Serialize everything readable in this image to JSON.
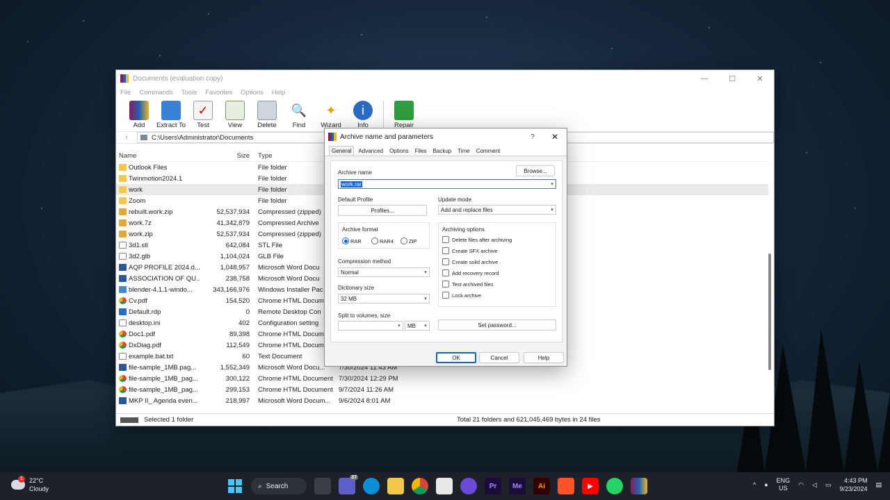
{
  "window": {
    "title": "Documents (evaluation copy)",
    "menu": [
      "File",
      "Commands",
      "Tools",
      "Favorites",
      "Options",
      "Help"
    ],
    "toolbar": [
      "Add",
      "Extract To",
      "Test",
      "View",
      "Delete",
      "Find",
      "Wizard",
      "Info",
      "Repair"
    ],
    "path": "C:\\Users\\Administrator\\Documents",
    "columns": {
      "name": "Name",
      "size": "Size",
      "type": "Type"
    },
    "files": [
      {
        "name": "Outlook Files",
        "size": "",
        "type": "File folder",
        "modified": "",
        "icon": "folder"
      },
      {
        "name": "Twinmotion2024.1",
        "size": "",
        "type": "File folder",
        "modified": "",
        "icon": "folder"
      },
      {
        "name": "work",
        "size": "",
        "type": "File folder",
        "modified": "",
        "icon": "folder"
      },
      {
        "name": "Zoom",
        "size": "",
        "type": "File folder",
        "modified": "",
        "icon": "folder"
      },
      {
        "name": "rebuilt.work.zip",
        "size": "52,537,934",
        "type": "Compressed (zipped)",
        "modified": "",
        "icon": "zip"
      },
      {
        "name": "work.7z",
        "size": "41,342,879",
        "type": "Compressed Archive",
        "modified": "",
        "icon": "zip"
      },
      {
        "name": "work.zip",
        "size": "52,537,934",
        "type": "Compressed (zipped)",
        "modified": "",
        "icon": "zip"
      },
      {
        "name": "3d1.stl",
        "size": "642,084",
        "type": "STL File",
        "modified": "",
        "icon": "file"
      },
      {
        "name": "3d2.glb",
        "size": "1,104,024",
        "type": "GLB File",
        "modified": "",
        "icon": "file"
      },
      {
        "name": "AQP PROFILE 2024.d...",
        "size": "1,048,957",
        "type": "Microsoft Word Docu",
        "modified": "",
        "icon": "word"
      },
      {
        "name": "ASSOCIATION OF QU...",
        "size": "238,758",
        "type": "Microsoft Word Docu",
        "modified": "",
        "icon": "word"
      },
      {
        "name": "blender-4.1.1-windo...",
        "size": "343,166,976",
        "type": "Windows Installer Pac",
        "modified": "",
        "icon": "msi"
      },
      {
        "name": "Cv.pdf",
        "size": "154,520",
        "type": "Chrome HTML Docum",
        "modified": "",
        "icon": "chrome"
      },
      {
        "name": "Default.rdp",
        "size": "0",
        "type": "Remote Desktop Con",
        "modified": "",
        "icon": "rdp"
      },
      {
        "name": "desktop.ini",
        "size": "402",
        "type": "Configuration setting",
        "modified": "",
        "icon": "file"
      },
      {
        "name": "Doc1.pdf",
        "size": "89,398",
        "type": "Chrome HTML Docum",
        "modified": "",
        "icon": "chrome"
      },
      {
        "name": "DxDiag.pdf",
        "size": "112,549",
        "type": "Chrome HTML Docum",
        "modified": "",
        "icon": "chrome"
      },
      {
        "name": "example.bat.txt",
        "size": "60",
        "type": "Text Document",
        "modified": "",
        "icon": "file"
      },
      {
        "name": "file-sample_1MB.pag...",
        "size": "1,552,349",
        "type": "Microsoft Word Docu...",
        "modified": "7/30/2024 11:43 AM",
        "icon": "word"
      },
      {
        "name": "file-sample_1MB_pag...",
        "size": "300,122",
        "type": "Chrome HTML Document",
        "modified": "7/30/2024 12:29 PM",
        "icon": "chrome"
      },
      {
        "name": "file-sample_1MB_pag...",
        "size": "299,153",
        "type": "Chrome HTML Document",
        "modified": "9/7/2024 11:26 AM",
        "icon": "chrome"
      },
      {
        "name": "MKP II_ Agenda even...",
        "size": "218,997",
        "type": "Microsoft Word Docum...",
        "modified": "9/6/2024 8:01 AM",
        "icon": "word"
      }
    ],
    "selected_index": 2,
    "status_left": "Selected 1 folder",
    "status_right": "Total 21 folders and 621,045,469 bytes in 24 files",
    "scroll_position": 0.35
  },
  "dialog": {
    "title": "Archive name and parameters",
    "help": "?",
    "close": "✕",
    "tabs": [
      "General",
      "Advanced",
      "Options",
      "Files",
      "Backup",
      "Time",
      "Comment"
    ],
    "archive_name_label": "Archive name",
    "archive_name": "work.rar",
    "browse": "Browse...",
    "default_profile_label": "Default Profile",
    "profiles": "Profiles...",
    "update_mode_label": "Update mode",
    "update_mode": "Add and replace files",
    "archive_format_label": "Archive format",
    "formats": [
      "RAR",
      "RAR4",
      "ZIP"
    ],
    "selected_format": "RAR",
    "archiving_options_label": "Archiving options",
    "options": [
      "Delete files after archiving",
      "Create SFX archive",
      "Create solid archive",
      "Add recovery record",
      "Test archived files",
      "Lock archive"
    ],
    "compression_method_label": "Compression method",
    "compression_method": "Normal",
    "dictionary_size_label": "Dictionary size",
    "dictionary_size": "32 MB",
    "split_label": "Split to volumes, size",
    "split_value": "",
    "split_unit": "MB",
    "set_password": "Set password...",
    "ok": "OK",
    "cancel": "Cancel",
    "help_btn": "Help"
  },
  "taskbar": {
    "temp": "22°C",
    "weather": "Cloudy",
    "weather_badge": "1",
    "search": "Search",
    "teams_badge": "27",
    "icons": [
      "start-icon",
      "task-view-icon",
      "teams-icon",
      "edge-icon",
      "file-explorer-icon",
      "chrome-icon",
      "store-icon",
      "copilot-icon",
      "premiere-icon",
      "media-encoder-icon",
      "illustrator-icon",
      "brave-icon",
      "youtube-icon",
      "whatsapp-icon",
      "winrar-icon"
    ],
    "lang1": "ENG",
    "lang2": "US",
    "time": "4:43 PM",
    "date": "9/23/2024"
  },
  "colors": {
    "accent": "#0a64d8",
    "taskbar": "#1d2228"
  }
}
